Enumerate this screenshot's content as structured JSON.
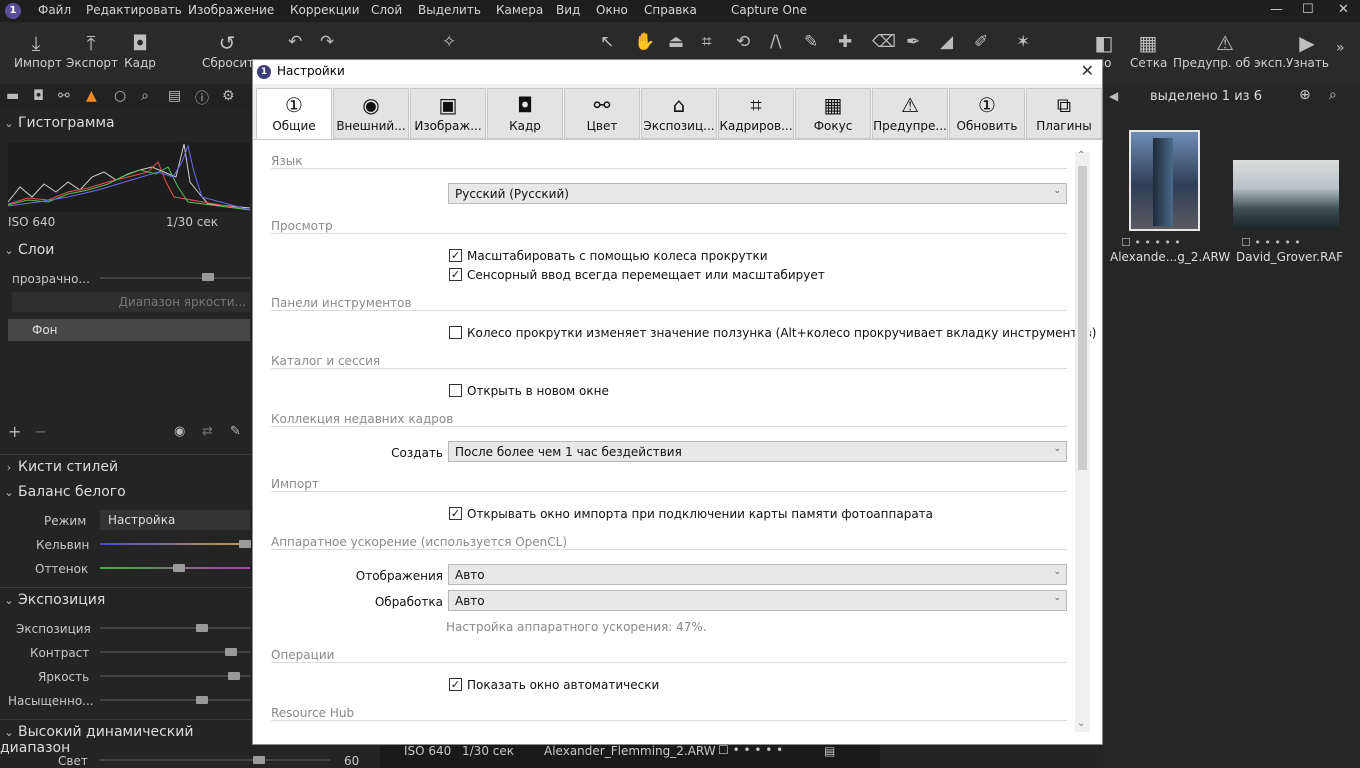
{
  "app_title": "Capture One",
  "menu": [
    "Файл",
    "Редактировать",
    "Изображение",
    "Коррекции",
    "Слой",
    "Выделить",
    "Камера",
    "Вид",
    "Окно",
    "Справка"
  ],
  "toolbar": {
    "import": "Импорт",
    "export": "Экспорт",
    "crop": "Кадр",
    "reset": "Сбросить",
    "grid": "Сетка",
    "exposure_warning": "Предупр. об эксп.",
    "learn": "Узнать",
    "cut_label": "ло"
  },
  "left": {
    "histogram_title": "Гистограмма",
    "iso": "ISO 640",
    "shutter": "1/30 сек",
    "layers_title": "Слои",
    "opacity_label": "прозрачно...",
    "luma_range": "Диапазон яркости...",
    "background_layer": "Фон",
    "style_brushes": "Кисти стилей",
    "white_balance": "Баланс белого",
    "mode_label": "Режим",
    "mode_value": "Настройка",
    "kelvin": "Кельвин",
    "tint": "Оттенок",
    "exposure_title": "Экспозиция",
    "exposure": "Экспозиция",
    "contrast": "Контраст",
    "brightness": "Яркость",
    "saturation": "Насыщенно...",
    "hdr_title": "Высокий динамический диапазон",
    "highlight": "Свет",
    "highlight_value": "60"
  },
  "right": {
    "selected": "выделено 1 из 6",
    "thumb1": "Alexande...g_2.ARW",
    "thumb2": "David_Grover.RAF"
  },
  "bottom": {
    "iso": "ISO 640",
    "shutter": "1/30 сек",
    "filename": "Alexander_Flemming_2.ARW"
  },
  "dialog": {
    "title": "Настройки",
    "tabs": [
      {
        "label": "Общие",
        "icon": "①"
      },
      {
        "label": "Внешний...",
        "icon": "◉"
      },
      {
        "label": "Изображ...",
        "icon": "▣"
      },
      {
        "label": "Кадр",
        "icon": "◘"
      },
      {
        "label": "Цвет",
        "icon": "⚯"
      },
      {
        "label": "Экспозиц...",
        "icon": "⌂"
      },
      {
        "label": "Кадриров...",
        "icon": "⌗"
      },
      {
        "label": "Фокус",
        "icon": "▦"
      },
      {
        "label": "Предупре...",
        "icon": "⚠"
      },
      {
        "label": "Обновить",
        "icon": "①"
      },
      {
        "label": "Плагины",
        "icon": "⧉"
      }
    ],
    "language_header": "Язык",
    "language_value": "Русский (Русский)",
    "viewer_header": "Просмотр",
    "viewer_opt1": "Масштабировать с помощью колеса прокрутки",
    "viewer_opt2": "Сенсорный ввод всегда перемещает или масштабирует",
    "tools_header": "Панели инструментов",
    "tools_opt": "Колесо прокрутки изменяет значение ползунка (Alt+колесо прокручивает вкладку инструментов)",
    "catalog_header": "Каталог и сессия",
    "catalog_opt": "Открыть в новом окне",
    "recent_header": "Коллекция недавних кадров",
    "create_label": "Создать",
    "create_value": "После более чем 1 час бездействия",
    "import_header": "Импорт",
    "import_opt": "Открывать окно импорта при подключении карты памяти фотоаппарата",
    "hw_header": "Аппаратное ускорение (используется OpenCL)",
    "display_label": "Отображения",
    "display_value": "Авто",
    "processing_label": "Обработка",
    "processing_value": "Авто",
    "hw_note": "Настройка аппаратного ускорения: 47%.",
    "ops_header": "Операции",
    "ops_opt": "Показать окно автоматически",
    "resource_header": "Resource Hub"
  }
}
